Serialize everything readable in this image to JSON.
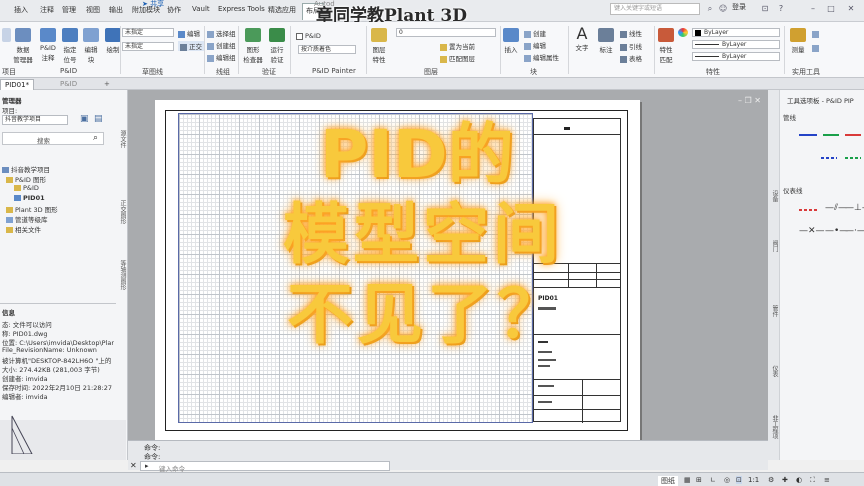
{
  "title_bar": {
    "faded_app_title": "Autod",
    "overlay_title": "章同学教Plant 3D",
    "search_placeholder": "键入关键字或短语",
    "login_label": "登录"
  },
  "menu": {
    "items": [
      "插入",
      "注释",
      "管理",
      "视图",
      "输出",
      "附加模块",
      "协作",
      "Vault",
      "Express Tools",
      "精选应用",
      "布局"
    ],
    "share_label": "共享",
    "active_index": 10
  },
  "ribbon": {
    "left_buttons": [
      {
        "label": "数据\n管理器"
      },
      {
        "label": "P&ID\n注释"
      },
      {
        "label": "指定\n位号"
      },
      {
        "label": "编辑\n块"
      },
      {
        "label": "绘制"
      }
    ],
    "left_group_labels": [
      "项目",
      "P&ID"
    ],
    "line_dd1": "未指定",
    "line_dd2": "未指定",
    "line_group_label": "草图线",
    "edit_small": [
      "编辑",
      "正交"
    ],
    "group_small": [
      "选择组",
      "创建组",
      "编辑组"
    ],
    "group_label": "组",
    "line_label": "线组",
    "check_buttons": [
      {
        "label": "图形\n检查器"
      },
      {
        "label": "运行\n验证"
      }
    ],
    "check_label": "验证",
    "pid_painter_label": "P&ID Painter",
    "pid_check": "P&ID",
    "pid_dd": "按介质着色",
    "layer_btn": "图层\n特性",
    "layer_label": "图层",
    "layer_dd": "0",
    "layer_small": [
      "置为当前",
      "匹配图层"
    ],
    "insert_btn": "插入",
    "block_small": [
      "创建",
      "编辑",
      "编辑属性"
    ],
    "block_label": "块",
    "text_btns": [
      {
        "label": "文字"
      },
      {
        "label": "标注"
      }
    ],
    "annot_small": [
      "线性",
      "引线",
      "表格"
    ],
    "match_btn": "特性\n匹配",
    "prop_dd": [
      "ByLayer",
      "ByLayer",
      "ByLayer"
    ],
    "prop_label": "特性",
    "measure_btn": "测量",
    "util_label": "实用工具"
  },
  "doc_tabs": [
    "PID01*",
    "P&ID"
  ],
  "project_manager": {
    "header": "管理器",
    "project_label": "项目:",
    "project_value": "抖音教学项目",
    "search_label": "搜索",
    "tree": [
      {
        "label": "抖音教学项目",
        "indent": 0
      },
      {
        "label": "P&ID 图形",
        "indent": 1
      },
      {
        "label": "P&ID",
        "indent": 2
      },
      {
        "label": "PID01",
        "indent": 2,
        "bold": true
      },
      {
        "label": "Plant 3D 图形",
        "indent": 1
      },
      {
        "label": "管道等级库",
        "indent": 1
      },
      {
        "label": "相关文件",
        "indent": 1
      }
    ],
    "side_labels": [
      "源文件",
      "正交图形",
      "等轴测图形"
    ],
    "details_header": "信息",
    "details": [
      "态: 文件可以访问",
      "称: PID01.dwg",
      "位置: C:\\Users\\imvida\\Desktop\\Plan",
      "File_RevisionName:  Unknown",
      "被计算机\"DESKTOP-842LH6O \"上的",
      "大小: 274.42KB (281,003 字节)",
      "创建者: imvida",
      "保存时间: 2022年2月10日 21:28:27",
      "编辑者: imvida"
    ]
  },
  "title_block": {
    "drawing_no": "PID01"
  },
  "overlay_text": {
    "line1": "PID的",
    "line2": "模型空间",
    "line3": "不见了？"
  },
  "tool_palette": {
    "header": "工具选项板 - P&ID PIP",
    "section1": "管线",
    "section2": "仪表线",
    "side_tabs": [
      "设备",
      "阀门",
      "管件",
      "仪表",
      "非工程项"
    ],
    "line_colors": [
      "#2443c7",
      "#1aa04a",
      "#d93a3a"
    ]
  },
  "command": {
    "history": [
      "命令:",
      "命令:"
    ],
    "prompt": "键入命令"
  },
  "status_bar": {
    "layout_label": "图纸",
    "scale_label": "1:1"
  }
}
